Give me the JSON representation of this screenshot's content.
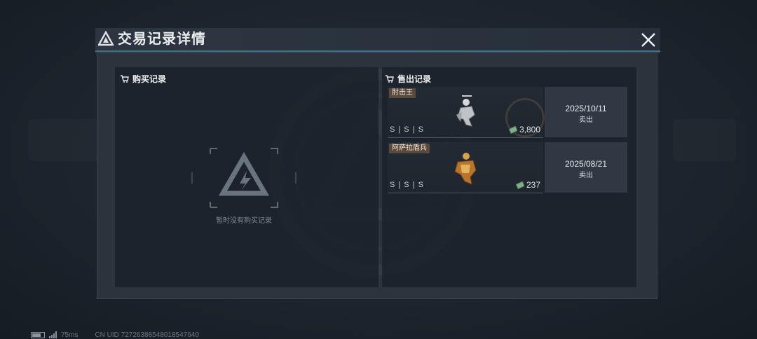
{
  "dialog": {
    "title": "交易记录详情",
    "close_icon": "close-icon"
  },
  "purchase": {
    "header": "购买记录",
    "empty_text": "暂时没有购买记录"
  },
  "sales": {
    "header": "售出记录",
    "records": [
      {
        "name": "肘击王",
        "grade": "S | S | S",
        "price": "3,800",
        "date": "2025/10/11",
        "status": "卖出"
      },
      {
        "name": "阿萨拉盾兵",
        "grade": "S | S | S",
        "price": "237",
        "date": "2025/08/21",
        "status": "卖出"
      }
    ]
  },
  "footer": {
    "ping": "75ms",
    "uid": "CN UID 72726386548018547640"
  },
  "colors": {
    "accent_line": "#3f6f8a",
    "tag_bg": "#5a4a3e",
    "currency": "#7fb08a"
  }
}
